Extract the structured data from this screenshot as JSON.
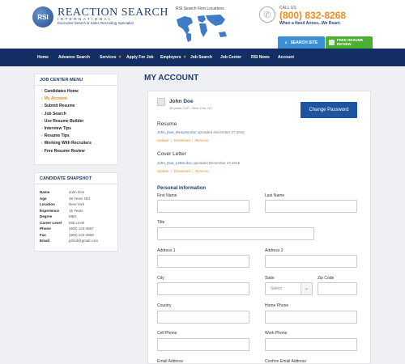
{
  "header": {
    "logo_text": "RSI",
    "brand": "REACTION SEARCH",
    "brand_sub": "INTERNATIONAL",
    "brand_tag": "Executive Search & Sales Recruiting Specialist",
    "map_label": "RSI Search Firm Locations",
    "call_label": "CALL US",
    "phone": "(800) 832-8268",
    "tagline": "When a Need Arises...We React.",
    "search_site_label": "SEARCH SITE",
    "free_review_label": "FREE RESUME REVIEW"
  },
  "nav": {
    "items": [
      "Home",
      "Advance Search",
      "Services",
      "Apply For Job",
      "Employers",
      "Job Search",
      "Job Center",
      "RSI News",
      "Account"
    ]
  },
  "sidebar": {
    "menu_title": "JOB CENTER MENU",
    "menu_items": [
      "Candidates Home",
      "My Account",
      "Submit Resume",
      "Job Search",
      "Use Resume Builder",
      "Interview Tips",
      "Resume Tips",
      "Working With Recruiters",
      "Free Resume Review"
    ],
    "active_item": "My Account",
    "snapshot_title": "CANDIDATE SNAPSHOT",
    "snapshot": [
      {
        "k": "Name",
        "v": "John Doe"
      },
      {
        "k": "Age",
        "v": "38 Years Old"
      },
      {
        "k": "Location",
        "v": "New York"
      },
      {
        "k": "Experience",
        "v": "15 Years"
      },
      {
        "k": "Degree",
        "v": "MBA"
      },
      {
        "k": "Career Level",
        "v": "Mid Level"
      },
      {
        "k": "Phone",
        "v": "(800) 123-4567"
      },
      {
        "k": "Fax",
        "v": "(800) 123-4568"
      },
      {
        "k": "Email",
        "v": "johnd@gmail.com"
      }
    ]
  },
  "main": {
    "title": "MY ACCOUNT",
    "user": {
      "name": "John Doe",
      "meta": "38 years OLD - New York, NY"
    },
    "change_password_label": "Change Password",
    "resume": {
      "heading": "Resume",
      "file": "John_Doe_Resume.doc",
      "uploaded": "uploaded December 27,2015"
    },
    "cover": {
      "heading": "Cover Letter",
      "file": "John_Doe_Letter.doc",
      "uploaded": "uploaded December 27,2015"
    },
    "actions": {
      "update": "Update",
      "download": "Download",
      "remove": "Remove"
    },
    "personal_info_heading": "Personal Information",
    "fields": {
      "first_name": "First Name",
      "last_name": "Last Name",
      "title": "Title",
      "address1": "Address 1",
      "address2": "Address 2",
      "city": "City",
      "state": "State",
      "state_value": "Select",
      "zip": "Zip Code",
      "country": "Country",
      "home_phone": "Home Phone",
      "cell_phone": "Cell Phone",
      "work_phone": "Work Phone",
      "email": "Email Address",
      "confirm_email": "Confirm Email Address"
    }
  },
  "colors": {
    "navy": "#132e62",
    "orange": "#f08a1c",
    "blue": "#1e54a0",
    "green": "#4caf31"
  }
}
